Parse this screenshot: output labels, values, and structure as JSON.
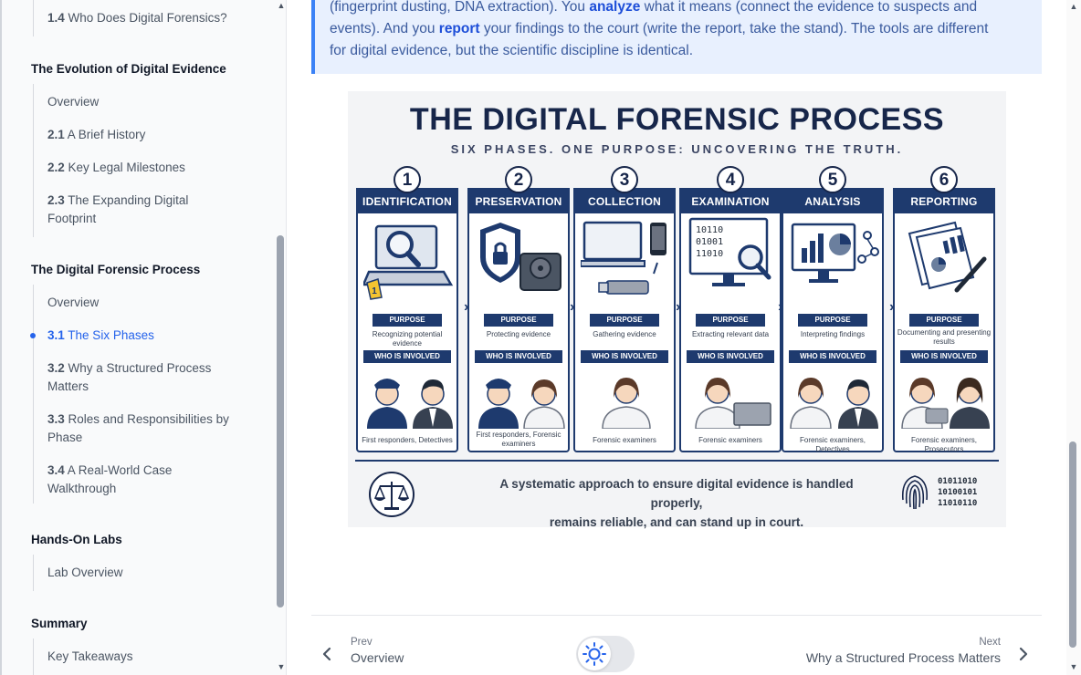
{
  "sidebar": {
    "top_item": {
      "num": "1.4",
      "label": "Who Does Digital Forensics?"
    },
    "sections": [
      {
        "title": "The Evolution of Digital Evidence",
        "items": [
          {
            "num": "",
            "label": "Overview"
          },
          {
            "num": "2.1",
            "label": "A Brief History"
          },
          {
            "num": "2.2",
            "label": "Key Legal Milestones"
          },
          {
            "num": "2.3",
            "label": "The Expanding Digital Footprint"
          }
        ]
      },
      {
        "title": "The Digital Forensic Process",
        "items": [
          {
            "num": "",
            "label": "Overview"
          },
          {
            "num": "3.1",
            "label": "The Six Phases",
            "active": true
          },
          {
            "num": "3.2",
            "label": "Why a Structured Process Matters"
          },
          {
            "num": "3.3",
            "label": "Roles and Responsibilities by Phase"
          },
          {
            "num": "3.4",
            "label": "A Real-World Case Walkthrough"
          }
        ]
      },
      {
        "title": "Hands-On Labs",
        "items": [
          {
            "num": "",
            "label": "Lab Overview"
          }
        ]
      },
      {
        "title": "Summary",
        "items": [
          {
            "num": "",
            "label": "Key Takeaways"
          }
        ]
      }
    ]
  },
  "callout": {
    "line1_pre": "(fingerprint dusting, DNA extraction). You ",
    "line1_strong": "analyze",
    "line1_post": " what it means (connect the evidence to suspects and",
    "line2_pre": "events). And you ",
    "line2_strong": "report",
    "line2_post": " your findings to the court (write the report, take the stand). The tools are different",
    "line3": "for digital evidence, but the scientific discipline is identical."
  },
  "figure": {
    "title": "THE DIGITAL FORENSIC PROCESS",
    "subtitle": "SIX PHASES. ONE PURPOSE: UNCOVERING THE TRUTH.",
    "purpose_label": "PURPOSE",
    "who_label": "WHO IS INVOLVED",
    "phases": [
      {
        "num": "1",
        "name": "IDENTIFICATION",
        "purpose": "Recognizing potential evidence",
        "who": "First responders, Detectives"
      },
      {
        "num": "2",
        "name": "PRESERVATION",
        "purpose": "Protecting evidence",
        "who": "First responders, Forensic examiners"
      },
      {
        "num": "3",
        "name": "COLLECTION",
        "purpose": "Gathering evidence",
        "who": "Forensic examiners"
      },
      {
        "num": "4",
        "name": "EXAMINATION",
        "purpose": "Extracting relevant data",
        "who": "Forensic examiners"
      },
      {
        "num": "5",
        "name": "ANALYSIS",
        "purpose": "Interpreting findings",
        "who": "Forensic examiners, Detectives"
      },
      {
        "num": "6",
        "name": "REPORTING",
        "purpose": "Documenting and presenting results",
        "who": "Forensic examiners, Prosecutors"
      }
    ],
    "marker_label": "1",
    "binary_code": [
      "10110",
      "01001",
      "11010"
    ],
    "footer_line1": "A systematic approach to ensure digital evidence is handled properly,",
    "footer_line2": "remains reliable, and can stand up in court.",
    "footer_binary": [
      "01011010",
      "10100101",
      "11010110"
    ]
  },
  "pager": {
    "prev_small": "Prev",
    "prev_title": "Overview",
    "next_small": "Next",
    "next_title": "Why a Structured Process Matters"
  },
  "icons": {
    "theme": "sun-icon",
    "prev": "chevron-left-icon",
    "next": "chevron-right-icon"
  },
  "colors": {
    "accent": "#2563eb",
    "navy": "#1e3a6e",
    "callout_bg": "#e8f0fe",
    "callout_border": "#3b82f6"
  }
}
